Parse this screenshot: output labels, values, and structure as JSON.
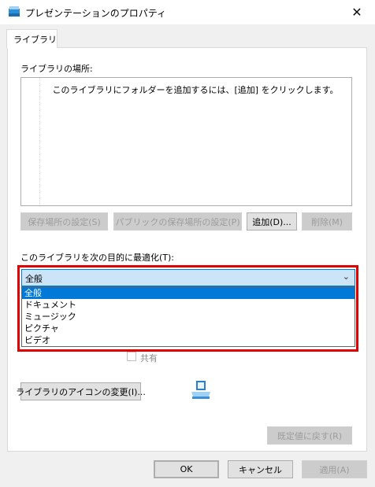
{
  "window": {
    "title": "プレゼンテーションのプロパティ",
    "close_glyph": "✕"
  },
  "tabs": [
    {
      "label": "ライブラリ"
    }
  ],
  "library": {
    "locations_label": "ライブラリの場所:",
    "empty_message": "このライブラリにフォルダーを追加するには、[追加] をクリックします。",
    "buttons": {
      "set_save_location": "保存場所の設定(S)",
      "set_public_save_location": "パブリックの保存場所の設定(P)",
      "add": "追加(D)...",
      "remove": "削除(M)"
    }
  },
  "optimize": {
    "label": "このライブラリを次の目的に最適化(T):",
    "selected": "全般",
    "arrow": "⌄",
    "options": [
      "全般",
      "ドキュメント",
      "ミュージック",
      "ピクチャ",
      "ビデオ"
    ],
    "highlight_color": "#e00000"
  },
  "shared": {
    "label": "共有",
    "checked": false
  },
  "change_icon_button": "ライブラリのアイコンの変更(I)...",
  "restore_defaults_button": "既定値に戻す(R)",
  "footer": {
    "ok": "OK",
    "cancel": "キャンセル",
    "apply": "適用(A)"
  }
}
